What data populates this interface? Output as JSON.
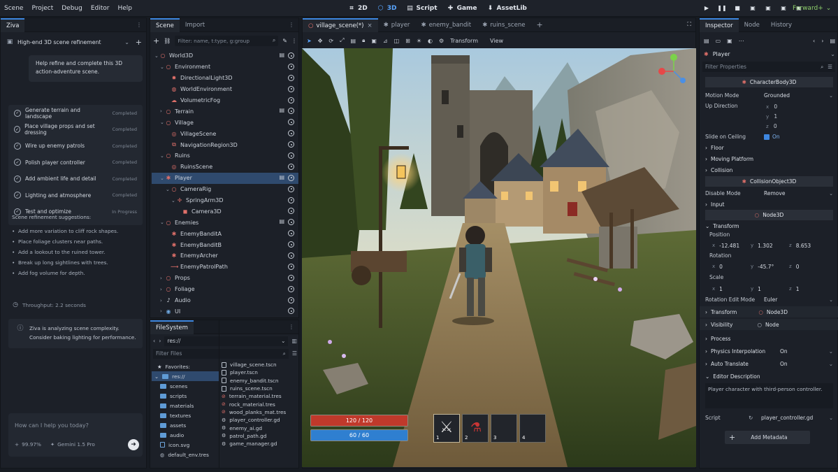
{
  "menu": [
    "Scene",
    "Project",
    "Debug",
    "Editor",
    "Help"
  ],
  "modes": [
    {
      "label": "2D",
      "icon": "2d-icon",
      "active": false
    },
    {
      "label": "3D",
      "icon": "3d-icon",
      "active": true
    },
    {
      "label": "Script",
      "icon": "script-icon",
      "active": false
    },
    {
      "label": "Game",
      "icon": "game-icon",
      "active": false
    },
    {
      "label": "AssetLib",
      "icon": "assetlib-icon",
      "active": false
    }
  ],
  "renderer": "Forward+",
  "ziva": {
    "tab": "Ziva",
    "session": "High-end 3D scene refinement",
    "prompt": "Help refine and complete this 3D action-adventure scene.",
    "tasks": [
      {
        "label": "Generate terrain and landscape",
        "status": "Completed"
      },
      {
        "label": "Place village props and set dressing",
        "status": "Completed"
      },
      {
        "label": "Wire up enemy patrols",
        "status": "Completed"
      },
      {
        "label": "Polish player controller",
        "status": "Completed"
      },
      {
        "label": "Add ambient life and detail",
        "status": "Completed"
      },
      {
        "label": "Lighting and atmosphere",
        "status": "Completed"
      },
      {
        "label": "Test and optimize",
        "status": "In Progress"
      }
    ],
    "suggestions_title": "Scene refinement suggestions:",
    "suggestions": [
      "Add more variation to cliff rock shapes.",
      "Place foliage clusters near paths.",
      "Add a lookout to the ruined tower.",
      "Break up long sightlines with trees.",
      "Add fog volume for depth."
    ],
    "throughput": "Throughput: 2.2 seconds",
    "analysis": "Ziva is analyzing scene complexity. Consider baking lighting for performance.",
    "input_placeholder": "How can I help you today?",
    "zoom": "99.97%",
    "model": "Gemini 1.5 Pro"
  },
  "scene_panel": {
    "tabs": [
      "Scene",
      "Import"
    ],
    "filter_placeholder": "Filter: name, t:type, g:group",
    "nodes": [
      {
        "name": "World3D",
        "depth": 0,
        "icon": "node3d-icon",
        "script": true,
        "sel": false
      },
      {
        "name": "Environment",
        "depth": 1,
        "icon": "node3d-icon",
        "script": false,
        "sel": false
      },
      {
        "name": "DirectionalLight3D",
        "depth": 2,
        "icon": "light-icon",
        "script": false,
        "sel": false
      },
      {
        "name": "WorldEnvironment",
        "depth": 2,
        "icon": "globe-icon",
        "script": false,
        "sel": false
      },
      {
        "name": "VolumetricFog",
        "depth": 2,
        "icon": "fog-icon",
        "script": false,
        "sel": false
      },
      {
        "name": "Terrain",
        "depth": 1,
        "icon": "node3d-icon",
        "script": true,
        "sel": false
      },
      {
        "name": "Village",
        "depth": 1,
        "icon": "node3d-icon",
        "script": false,
        "sel": false
      },
      {
        "name": "VillageScene",
        "depth": 2,
        "icon": "scene-icon",
        "script": false,
        "sel": false
      },
      {
        "name": "NavigationRegion3D",
        "depth": 2,
        "icon": "nav-icon",
        "script": false,
        "sel": false
      },
      {
        "name": "Ruins",
        "depth": 1,
        "icon": "node3d-icon",
        "script": false,
        "sel": false
      },
      {
        "name": "RuinsScene",
        "depth": 2,
        "icon": "scene-icon",
        "script": false,
        "sel": false
      },
      {
        "name": "Player",
        "depth": 1,
        "icon": "character-icon",
        "script": true,
        "sel": true
      },
      {
        "name": "CameraRig",
        "depth": 2,
        "icon": "node3d-icon",
        "script": false,
        "sel": false
      },
      {
        "name": "SpringArm3D",
        "depth": 3,
        "icon": "springarm-icon",
        "script": false,
        "sel": false
      },
      {
        "name": "Camera3D",
        "depth": 4,
        "icon": "camera-icon",
        "script": false,
        "sel": false
      },
      {
        "name": "Enemies",
        "depth": 1,
        "icon": "node3d-icon",
        "script": true,
        "sel": false
      },
      {
        "name": "EnemyBanditA",
        "depth": 2,
        "icon": "character-icon",
        "script": false,
        "sel": false
      },
      {
        "name": "EnemyBanditB",
        "depth": 2,
        "icon": "character-icon",
        "script": false,
        "sel": false
      },
      {
        "name": "EnemyArcher",
        "depth": 2,
        "icon": "character-icon",
        "script": false,
        "sel": false
      },
      {
        "name": "EnemyPatrolPath",
        "depth": 2,
        "icon": "path-icon",
        "script": false,
        "sel": false
      },
      {
        "name": "Props",
        "depth": 1,
        "icon": "node3d-icon",
        "script": false,
        "sel": false
      },
      {
        "name": "Foliage",
        "depth": 1,
        "icon": "node3d-icon",
        "script": false,
        "sel": false
      },
      {
        "name": "Audio",
        "depth": 1,
        "icon": "audio-icon",
        "script": false,
        "sel": false
      },
      {
        "name": "UI",
        "depth": 1,
        "icon": "ui-icon",
        "script": false,
        "sel": false
      }
    ]
  },
  "filesystem": {
    "tab": "FileSystem",
    "path": "res://",
    "filter_placeholder": "Filter Files",
    "favorites": "Favorites:",
    "root": "res://",
    "folders": [
      "scenes",
      "scripts",
      "materials",
      "textures",
      "assets",
      "audio"
    ],
    "root_files": [
      "icon.svg",
      "default_env.tres"
    ],
    "files": [
      "village_scene.tscn",
      "player.tscn",
      "enemy_bandit.tscn",
      "ruins_scene.tscn",
      "terrain_material.tres",
      "rock_material.tres",
      "wood_planks_mat.tres",
      "player_controller.gd",
      "enemy_ai.gd",
      "patrol_path.gd",
      "game_manager.gd"
    ]
  },
  "viewport": {
    "tabs": [
      "village_scene(*)",
      "player",
      "enemy_bandit",
      "ruins_scene"
    ],
    "toolbar": [
      "Transform",
      "View"
    ],
    "hud": {
      "health": "120 / 120",
      "health_fraction": 1.0,
      "mana": "60 / 60",
      "mana_fraction": 1.0,
      "slots": [
        "1",
        "2",
        "3",
        "4"
      ]
    }
  },
  "inspector": {
    "tabs": [
      "Inspector",
      "Node",
      "History"
    ],
    "node": "Player",
    "filter_placeholder": "Filter Properties",
    "class1": "CharacterBody3D",
    "motion_mode_label": "Motion Mode",
    "motion_mode": "Grounded",
    "up_dir_label": "Up Direction",
    "up_x": "0",
    "up_y": "1",
    "up_z": "0",
    "slide_label": "Slide on Ceiling",
    "slide": "On",
    "floor": "Floor",
    "moving_platform": "Moving Platform",
    "collision": "Collision",
    "class2": "CollisionObject3D",
    "disable_mode_label": "Disable Mode",
    "disable_mode": "Remove",
    "input": "Input",
    "class3": "Node3D",
    "transform": "Transform",
    "position_label": "Position",
    "pos_x": "-12.481",
    "pos_y": "1.302",
    "pos_z": "8.653",
    "rotation_label": "Rotation",
    "rot_x": "0",
    "rot_y": "-45.7°",
    "rot_z": "0",
    "scale_label": "Scale",
    "sc_x": "1",
    "sc_y": "1",
    "sc_z": "1",
    "rot_mode_label": "Rotation Edit Mode",
    "rot_mode": "Euler",
    "transform2": "Transform",
    "transform2_val": "Node3D",
    "visibility": "Visibility",
    "visibility_val": "Node",
    "process": "Process",
    "phys_label": "Physics Interpolation",
    "phys": "On",
    "auto_label": "Auto Translate",
    "auto": "On",
    "editor_desc": "Editor Description",
    "desc_text": "Player character with third-person controller.",
    "script_label": "Script",
    "script": "player_controller.gd",
    "add_metadata": "Add Metadata"
  },
  "colors": {
    "accent": "#3e87e0",
    "selected": "#2f4a6e",
    "renderer": "#8fd16b",
    "health": "#c0392b",
    "mana": "#2f7fd0"
  }
}
